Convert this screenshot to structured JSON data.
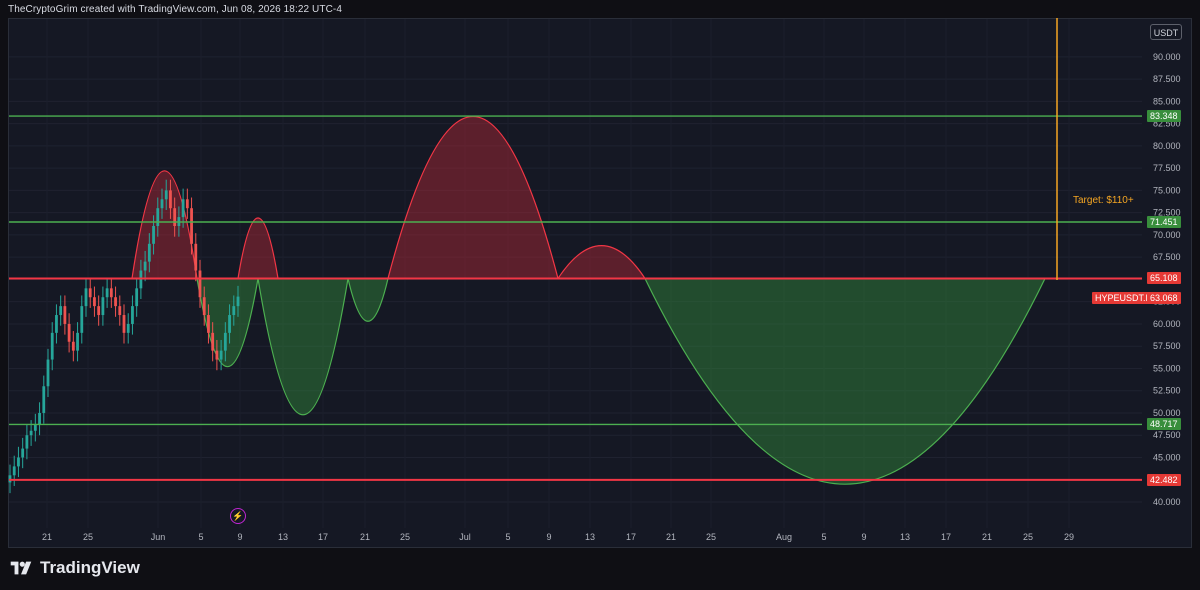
{
  "header": {
    "text": "TheCryptoGrim created with TradingView.com, Jun 08, 2026 18:22 UTC-4"
  },
  "currency_button": "USDT",
  "brand": {
    "name": "TradingView",
    "logo_icon": "tradingview-logo-icon"
  },
  "target_label": "Target: $110+",
  "event_icon": "lightning-icon",
  "colors": {
    "background": "#151824",
    "support_line": "#4caf50",
    "resistance_line": "#f23645",
    "target_line": "#f5a623",
    "red_fill": "rgba(180,40,55,0.45)",
    "green_fill": "rgba(50,140,60,0.45)",
    "candle_up": "#26a69a",
    "candle_down": "#ef5350"
  },
  "chart_data": {
    "type": "candlestick",
    "symbol": "HYPEUSDT.P",
    "price_axis": {
      "range": [
        38.5,
        92
      ],
      "ticks": [
        "40.000",
        "42.500",
        "45.000",
        "47.500",
        "50.000",
        "52.500",
        "55.000",
        "57.500",
        "60.000",
        "62.500",
        "65.000",
        "67.500",
        "70.000",
        "72.500",
        "75.000",
        "77.500",
        "80.000",
        "82.500",
        "85.000",
        "87.500",
        "90.000"
      ]
    },
    "time_axis": {
      "ticks": [
        "21",
        "25",
        "Jun",
        "5",
        "9",
        "13",
        "17",
        "21",
        "25",
        "Jul",
        "5",
        "9",
        "13",
        "17",
        "21",
        "25",
        "Aug",
        "5",
        "9",
        "13",
        "17",
        "21",
        "25",
        "29"
      ]
    },
    "horizontal_levels": [
      {
        "price": 83.348,
        "label": "83.348",
        "kind": "support"
      },
      {
        "price": 71.451,
        "label": "71.451",
        "kind": "support"
      },
      {
        "price": 65.108,
        "label": "65.108",
        "kind": "resistance"
      },
      {
        "price": 48.717,
        "label": "48.717",
        "kind": "support"
      },
      {
        "price": 42.482,
        "label": "42.482",
        "kind": "resistance"
      }
    ],
    "last_price": {
      "label": "HYPEUSDT.P",
      "value": "63.068",
      "price": 63.068
    },
    "target": {
      "text": "Target: $110+"
    },
    "close_series": [
      43,
      44,
      45,
      46,
      47.5,
      48,
      48.7,
      50,
      53,
      56,
      59,
      61,
      62,
      60,
      58,
      57,
      59,
      62,
      64,
      63,
      62,
      61,
      63,
      64,
      63,
      62,
      61,
      59,
      60,
      62,
      64,
      66,
      67,
      69,
      71,
      73,
      74,
      75,
      73,
      71,
      72,
      74,
      73,
      69,
      66,
      63,
      61,
      59,
      57,
      56,
      57,
      59,
      61,
      62,
      63.07
    ]
  }
}
